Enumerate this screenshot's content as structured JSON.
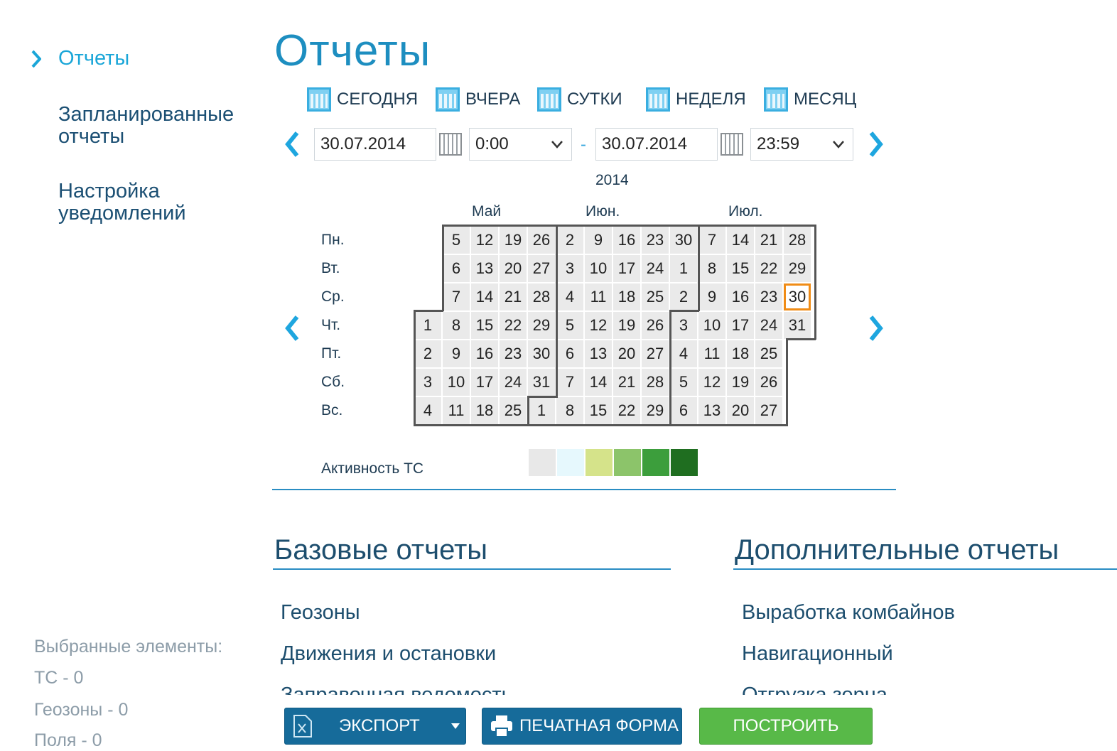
{
  "sidebar": {
    "active_label": "Отчеты",
    "items": [
      {
        "line1": "Запланированные",
        "line2": "отчеты"
      },
      {
        "line1": "Настройка",
        "line2": "уведомлений"
      }
    ],
    "selected": {
      "title": "Выбранные элементы:",
      "lines": [
        "ТС - 0",
        "Геозоны - 0",
        "Поля - 0"
      ]
    }
  },
  "header": {
    "title": "Отчеты"
  },
  "quick_periods": [
    "СЕГОДНЯ",
    "ВЧЕРА",
    "СУТКИ",
    "НЕДЕЛЯ",
    "МЕСЯЦ"
  ],
  "period": {
    "from_date": "30.07.2014",
    "from_time": "0:00",
    "separator": "-",
    "to_date": "30.07.2014",
    "to_time": "23:59"
  },
  "calendar": {
    "year": "2014",
    "months": [
      "Май",
      "Июн.",
      "Июл."
    ],
    "weekdays": [
      "Пн.",
      "Вт.",
      "Ср.",
      "Чт.",
      "Пт.",
      "Сб.",
      "Вс."
    ],
    "weeks": [
      [
        null,
        null,
        null,
        1,
        2,
        3,
        4
      ],
      [
        5,
        6,
        7,
        8,
        9,
        10,
        11
      ],
      [
        12,
        13,
        14,
        15,
        16,
        17,
        18
      ],
      [
        19,
        20,
        21,
        22,
        23,
        24,
        25
      ],
      [
        26,
        27,
        28,
        29,
        30,
        31,
        1
      ],
      [
        2,
        3,
        4,
        5,
        6,
        7,
        8
      ],
      [
        9,
        10,
        11,
        12,
        13,
        14,
        15
      ],
      [
        16,
        17,
        18,
        19,
        20,
        21,
        22
      ],
      [
        23,
        24,
        25,
        26,
        27,
        28,
        29
      ],
      [
        30,
        1,
        2,
        3,
        4,
        5,
        6
      ],
      [
        7,
        8,
        9,
        10,
        11,
        12,
        13
      ],
      [
        14,
        15,
        16,
        17,
        18,
        19,
        20
      ],
      [
        21,
        22,
        23,
        24,
        25,
        26,
        27
      ],
      [
        28,
        29,
        30,
        31,
        null,
        null,
        null
      ]
    ],
    "selected": {
      "week": 13,
      "day": 2
    },
    "activity_label": "Активность ТС",
    "activity_colors": [
      "#e8e8e8",
      "#e6f8fd",
      "#d5e38a",
      "#8cc46a",
      "#3c9e3c",
      "#1f6e20"
    ]
  },
  "basic_reports": {
    "title": "Базовые отчеты",
    "items": [
      "Геозоны",
      "Движения и остановки",
      "Заправочная ведомость"
    ]
  },
  "extra_reports": {
    "title": "Дополнительные отчеты",
    "items": [
      "Выработка комбайнов",
      "Навигационный",
      "Отгрузка зерна"
    ]
  },
  "actions": {
    "export": "ЭКСПОРТ",
    "print": "ПЕЧАТНАЯ ФОРМА",
    "build": "ПОСТРОИТЬ"
  }
}
